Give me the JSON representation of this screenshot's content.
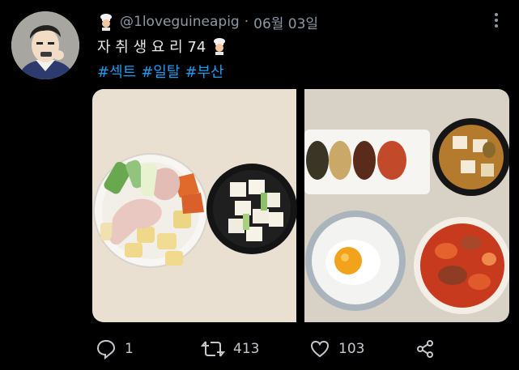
{
  "tweet": {
    "handle": "@1loveguineapig",
    "separator": "·",
    "date": "06월 03일",
    "title": "자 취 생 요 리 74",
    "hashtags": [
      "#섹트",
      "#일탈",
      "#부산"
    ]
  },
  "actions": {
    "reply_count": "1",
    "retweet_count": "413",
    "like_count": "103"
  },
  "colors": {
    "background": "#000000",
    "text": "#e7e9ea",
    "muted": "#8b98a5",
    "link": "#1d9bf0"
  },
  "icons": [
    "chef-emoji-icon",
    "more-icon",
    "reply-icon",
    "retweet-icon",
    "like-icon",
    "share-icon"
  ]
}
